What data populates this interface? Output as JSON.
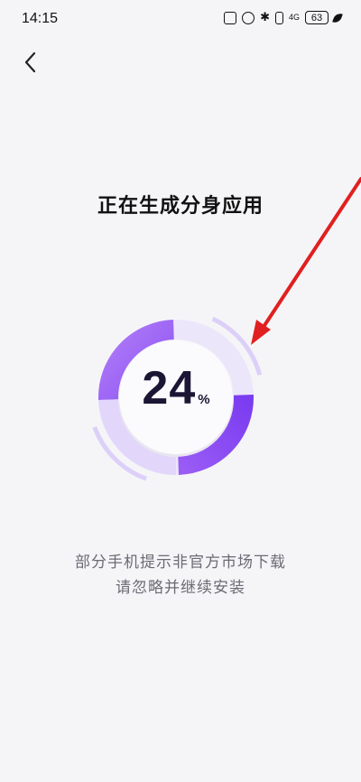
{
  "status_bar": {
    "time": "14:15",
    "network": "4G",
    "battery": "63"
  },
  "header": {
    "back_icon": "chevron-left-icon"
  },
  "main": {
    "title": "正在生成分身应用",
    "progress": {
      "value": 24,
      "unit": "%"
    },
    "hint_line1": "部分手机提示非官方市场下载",
    "hint_line2": "请忽略并继续安装"
  },
  "colors": {
    "accent": "#8a4ff2",
    "accent_light": "#b07cf7",
    "ring_track": "#e6defa",
    "arrow": "#e02020"
  }
}
